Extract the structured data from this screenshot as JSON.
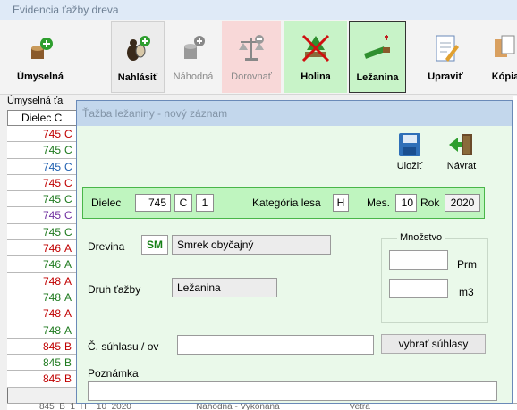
{
  "window": {
    "title": "Evidencia ťažby dreva"
  },
  "toolbar": {
    "umyselna": "Úmyselná",
    "nahlasit": "Nahlásiť",
    "nahodna": "Náhodná",
    "dorovnat": "Dorovnať",
    "holina": "Holina",
    "lezanina": "Ležanina",
    "upravit": "Upraviť",
    "kopia": "Kópia"
  },
  "background": {
    "section_title": "Úmyselná ťa",
    "column_header": "Dielec C",
    "rows": [
      {
        "num": "745",
        "code": "C",
        "color": "#c00000"
      },
      {
        "num": "745",
        "code": "C",
        "color": "#1f7a1f"
      },
      {
        "num": "745",
        "code": "C",
        "color": "#1f5fb0"
      },
      {
        "num": "745",
        "code": "C",
        "color": "#c00000"
      },
      {
        "num": "745",
        "code": "C",
        "color": "#1f7a1f"
      },
      {
        "num": "745",
        "code": "C",
        "color": "#7030a0"
      },
      {
        "num": "745",
        "code": "C",
        "color": "#1f7a1f"
      },
      {
        "num": "746",
        "code": "A",
        "color": "#c00000"
      },
      {
        "num": "746",
        "code": "A",
        "color": "#1f7a1f"
      },
      {
        "num": "748",
        "code": "A",
        "color": "#c00000"
      },
      {
        "num": "748",
        "code": "A",
        "color": "#1f7a1f"
      },
      {
        "num": "748",
        "code": "A",
        "color": "#c00000"
      },
      {
        "num": "748",
        "code": "A",
        "color": "#1f7a1f"
      },
      {
        "num": "845",
        "code": "B",
        "color": "#c00000"
      },
      {
        "num": "845",
        "code": "B",
        "color": "#1f7a1f"
      },
      {
        "num": "845",
        "code": "B",
        "color": "#c00000"
      }
    ],
    "bottom_row": "845  B  1  H    10  2020                          Náhodná - Vykonaná                            Vetra"
  },
  "dialog": {
    "title": "Ťažba ležaniny - nový záznam",
    "ulozit": "Uložiť",
    "navrat": "Návrat",
    "dielec_label": "Dielec",
    "dielec_value": "745",
    "dielec_code": "C",
    "dielec_part": "1",
    "kategoria_label": "Kategória lesa",
    "kategoria_value": "H",
    "mes_label": "Mes.",
    "mes_value": "10",
    "rok_label": "Rok",
    "rok_value": "2020",
    "drevina_label": "Drevina",
    "drevina_code": "SM",
    "drevina_name": "Smrek obyčajný",
    "druh_label": "Druh ťažby",
    "druh_value": "Ležanina",
    "suhlas_label": "Č. súhlasu / ov",
    "suhlas_value": "",
    "vybrat_button": "vybrať súhlasy",
    "poznamka_label": "Poznámka",
    "poznamka_value": "",
    "mnozstvo_legend": "Množstvo",
    "prm_label": "Prm",
    "prm_value": "",
    "m3_label": "m3",
    "m3_value": ""
  }
}
